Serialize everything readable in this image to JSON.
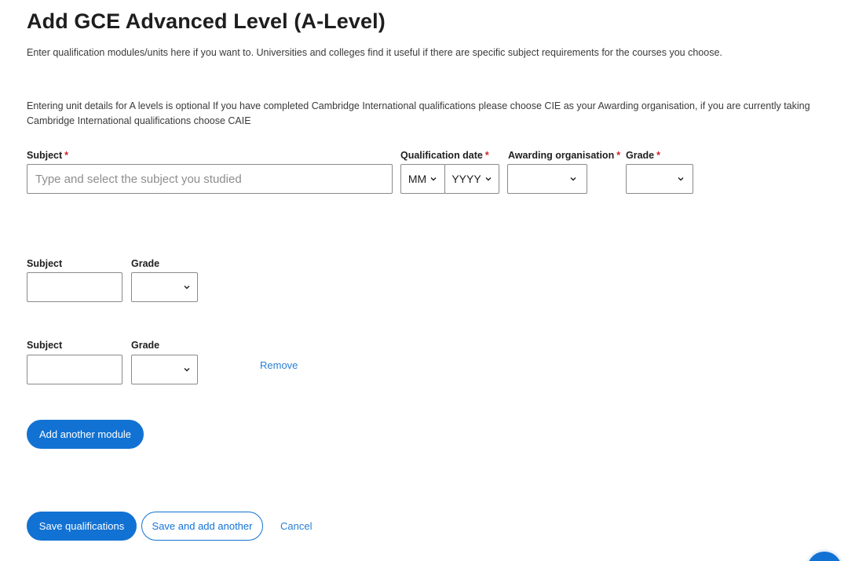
{
  "header": {
    "title": "Add GCE Advanced Level (A-Level)",
    "intro": "Enter qualification modules/units here if you want to. Universities and colleges find it useful if there are specific subject requirements for the courses you choose.",
    "note": "Entering unit details for A levels is optional If you have completed Cambridge International qualifications please choose CIE as your Awarding organisation, if you are currently taking Cambridge International qualifications choose CAIE"
  },
  "main_form": {
    "subject_label": "Subject",
    "subject_placeholder": "Type and select the subject you studied",
    "subject_value": "",
    "qualification_date_label": "Qualification date",
    "month_value": "MM",
    "year_value": "YYYY",
    "awarding_org_label": "Awarding organisation",
    "awarding_org_value": "",
    "grade_label": "Grade",
    "grade_value": "",
    "required_marker": "*"
  },
  "modules": [
    {
      "subject_label": "Subject",
      "subject_value": "",
      "grade_label": "Grade",
      "grade_value": ""
    },
    {
      "subject_label": "Subject",
      "subject_value": "",
      "grade_label": "Grade",
      "grade_value": "",
      "remove_label": "Remove"
    }
  ],
  "actions": {
    "add_module_label": "Add another module",
    "save_label": "Save qualifications",
    "save_add_label": "Save and add another",
    "cancel_label": "Cancel"
  },
  "colors": {
    "primary": "#1272d3",
    "required": "#d0212e",
    "link": "#2a7fd4"
  },
  "icons": {
    "dropdown": "chevron-down-icon",
    "help": "help-bubble"
  }
}
